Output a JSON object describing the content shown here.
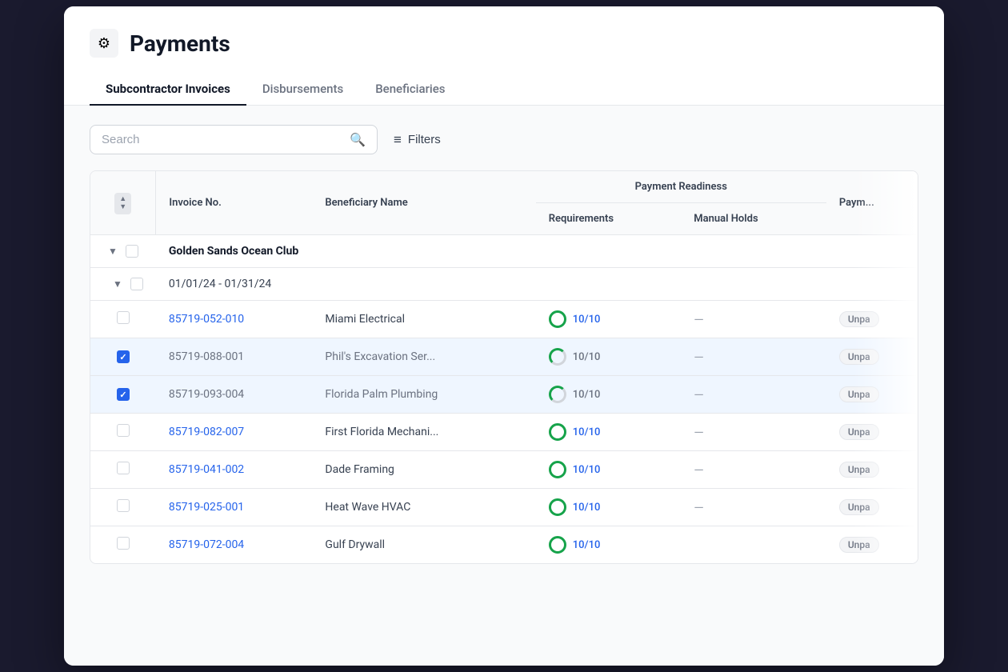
{
  "header": {
    "icon": "⚙",
    "title": "Payments",
    "tabs": [
      {
        "id": "subcontractor-invoices",
        "label": "Subcontractor Invoices",
        "active": true
      },
      {
        "id": "disbursements",
        "label": "Disbursements",
        "active": false
      },
      {
        "id": "beneficiaries",
        "label": "Beneficiaries",
        "active": false
      }
    ]
  },
  "toolbar": {
    "search_placeholder": "Search",
    "filters_label": "Filters"
  },
  "table": {
    "columns": {
      "sort": "",
      "invoice_no": "Invoice No.",
      "beneficiary_name": "Beneficiary Name",
      "payment_readiness_group": "Payment Readiness",
      "requirements": "Requirements",
      "manual_holds": "Manual Holds",
      "payment_status": "Paym..."
    },
    "group": {
      "name": "Golden Sands Ocean Club",
      "subgroup": {
        "date_range": "01/01/24 - 01/31/24",
        "rows": [
          {
            "id": 1,
            "invoice_no": "85719-052-010",
            "beneficiary": "Miami Electrical",
            "requirements": "10/10",
            "manual_holds": "—",
            "status": "Unpa",
            "selected": false,
            "circle_full": true
          },
          {
            "id": 2,
            "invoice_no": "85719-088-001",
            "beneficiary": "Phil's Excavation Ser...",
            "requirements": "10/10",
            "manual_holds": "—",
            "status": "Unpa",
            "selected": true,
            "circle_full": false
          },
          {
            "id": 3,
            "invoice_no": "85719-093-004",
            "beneficiary": "Florida Palm Plumbing",
            "requirements": "10/10",
            "manual_holds": "—",
            "status": "Unpa",
            "selected": true,
            "circle_full": false
          },
          {
            "id": 4,
            "invoice_no": "85719-082-007",
            "beneficiary": "First Florida Mechani...",
            "requirements": "10/10",
            "manual_holds": "—",
            "status": "Unpa",
            "selected": false,
            "circle_full": true
          },
          {
            "id": 5,
            "invoice_no": "85719-041-002",
            "beneficiary": "Dade Framing",
            "requirements": "10/10",
            "manual_holds": "—",
            "status": "Unpa",
            "selected": false,
            "circle_full": true
          },
          {
            "id": 6,
            "invoice_no": "85719-025-001",
            "beneficiary": "Heat Wave HVAC",
            "requirements": "10/10",
            "manual_holds": "—",
            "status": "Unpa",
            "selected": false,
            "circle_full": true
          },
          {
            "id": 7,
            "invoice_no": "85719-072-004",
            "beneficiary": "Gulf Drywall",
            "requirements": "10/10",
            "manual_holds": "",
            "status": "Unpa",
            "selected": false,
            "circle_full": true
          }
        ]
      }
    }
  }
}
